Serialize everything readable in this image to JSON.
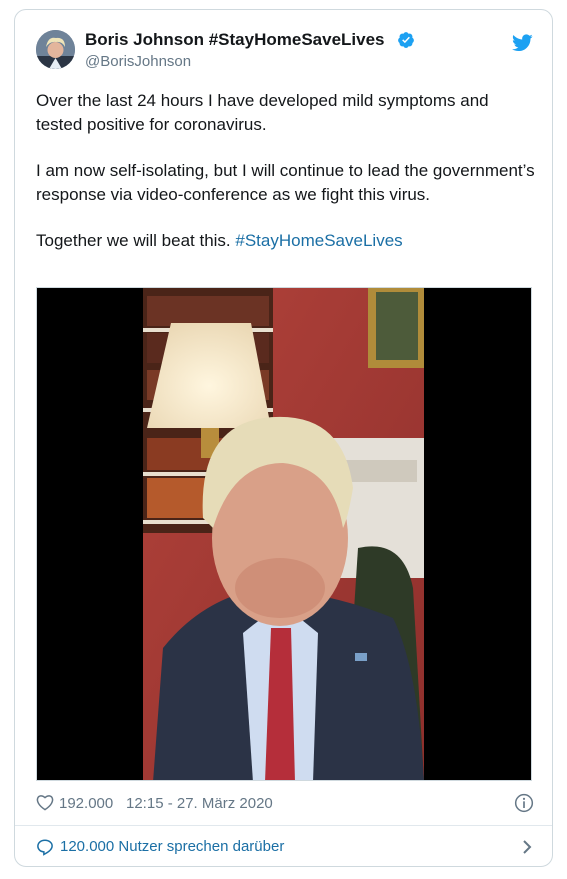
{
  "author": {
    "name": "Boris Johnson #StayHomeSaveLives",
    "handle": "@BorisJohnson",
    "verified": true
  },
  "tweet": {
    "paragraph_1": "Over the last 24 hours I have developed mild symptoms and tested positive for coronavirus.",
    "paragraph_2": "I am now self-isolating, but I will continue to lead the government’s response via video-conference as we fight this virus.",
    "paragraph_3_text": "Together we will beat this.",
    "paragraph_3_hashtag": "#StayHomeSaveLives"
  },
  "media": {
    "type": "video-thumbnail"
  },
  "footer": {
    "likes": "192.000",
    "timestamp": "12:15 - 27. März 2020",
    "conversation_label": "120.000 Nutzer sprechen darüber"
  },
  "icons": {
    "verified": "verified-badge-icon",
    "brand": "twitter-bird-icon",
    "like": "heart-icon",
    "info": "info-icon",
    "reply": "speech-bubble-icon",
    "more": "chevron-right-icon"
  },
  "colors": {
    "brand_blue": "#1da1f2",
    "link_blue": "#1b6fa5",
    "secondary_text": "#657786",
    "border": "#cfd9de"
  }
}
